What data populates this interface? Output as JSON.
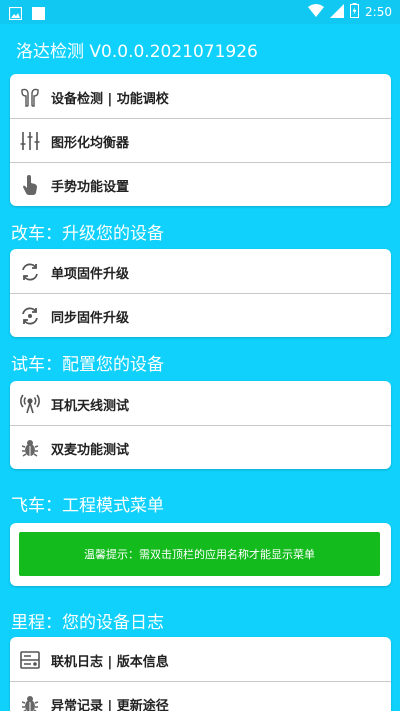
{
  "status_bar": {
    "time": "2:50",
    "icons": [
      "image-icon",
      "square-icon",
      "wifi-icon",
      "signal-icon",
      "battery-icon"
    ]
  },
  "app_bar": {
    "title": "洛达检测 V0.0.0.2021071926"
  },
  "sections": [
    {
      "title": "",
      "items": [
        {
          "label": "设备检测 | 功能调校",
          "icon": "earbuds-icon"
        },
        {
          "label": "图形化均衡器",
          "icon": "equalizer-icon"
        },
        {
          "label": "手势功能设置",
          "icon": "hand-pointer-icon"
        }
      ]
    },
    {
      "title": "改车：升级您的设备",
      "items": [
        {
          "label": "单项固件升级",
          "icon": "refresh-icon"
        },
        {
          "label": "同步固件升级",
          "icon": "sync-icon"
        }
      ]
    },
    {
      "title": "试车：配置您的设备",
      "items": [
        {
          "label": "耳机天线测试",
          "icon": "antenna-icon"
        },
        {
          "label": "双麦功能测试",
          "icon": "bug-icon"
        }
      ]
    },
    {
      "title": "飞车：工程模式菜单",
      "notice": "温馨提示：需双击顶栏的应用名称才能显示菜单"
    },
    {
      "title": "里程：您的设备日志",
      "items": [
        {
          "label": "联机日志 | 版本信息",
          "icon": "log-icon"
        },
        {
          "label": "异常记录 | 更新途径",
          "icon": "bug-icon"
        }
      ]
    }
  ],
  "colors": {
    "background": "#0fd1fb",
    "status_bar": "#11c8f2",
    "notice": "#13bb1c"
  }
}
